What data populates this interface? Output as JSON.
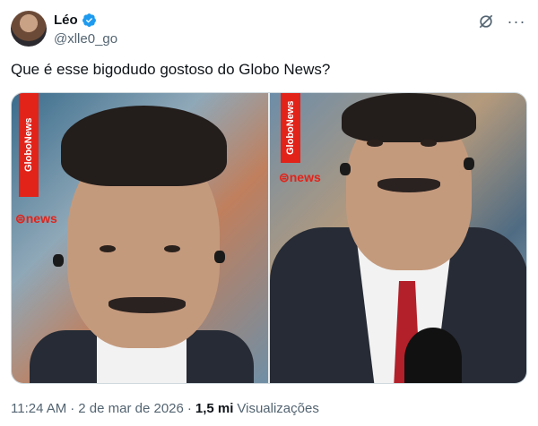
{
  "author": {
    "display_name": "Léo",
    "handle": "@xlle0_go",
    "verified": true,
    "avatar_icon": "avatar-photo"
  },
  "header_actions": {
    "grok_icon": "grok-icon",
    "more_icon": "more-dots-icon"
  },
  "tweet": {
    "text": "Que é esse bigodudo gostoso do Globo News?"
  },
  "media": {
    "overlay_left": {
      "brand_vertical": "GloboNews",
      "logo": "news"
    },
    "overlay_right": {
      "brand_vertical": "GloboNews",
      "logo": "news"
    }
  },
  "meta": {
    "time": "11:24 AM",
    "separator": "·",
    "date": "2 de mar de 2026",
    "views_count": "1,5 mi",
    "views_label": "Visualizações"
  },
  "colors": {
    "verified_blue": "#1d9bf0",
    "globo_red": "#e2231a",
    "secondary_text": "#536471"
  }
}
